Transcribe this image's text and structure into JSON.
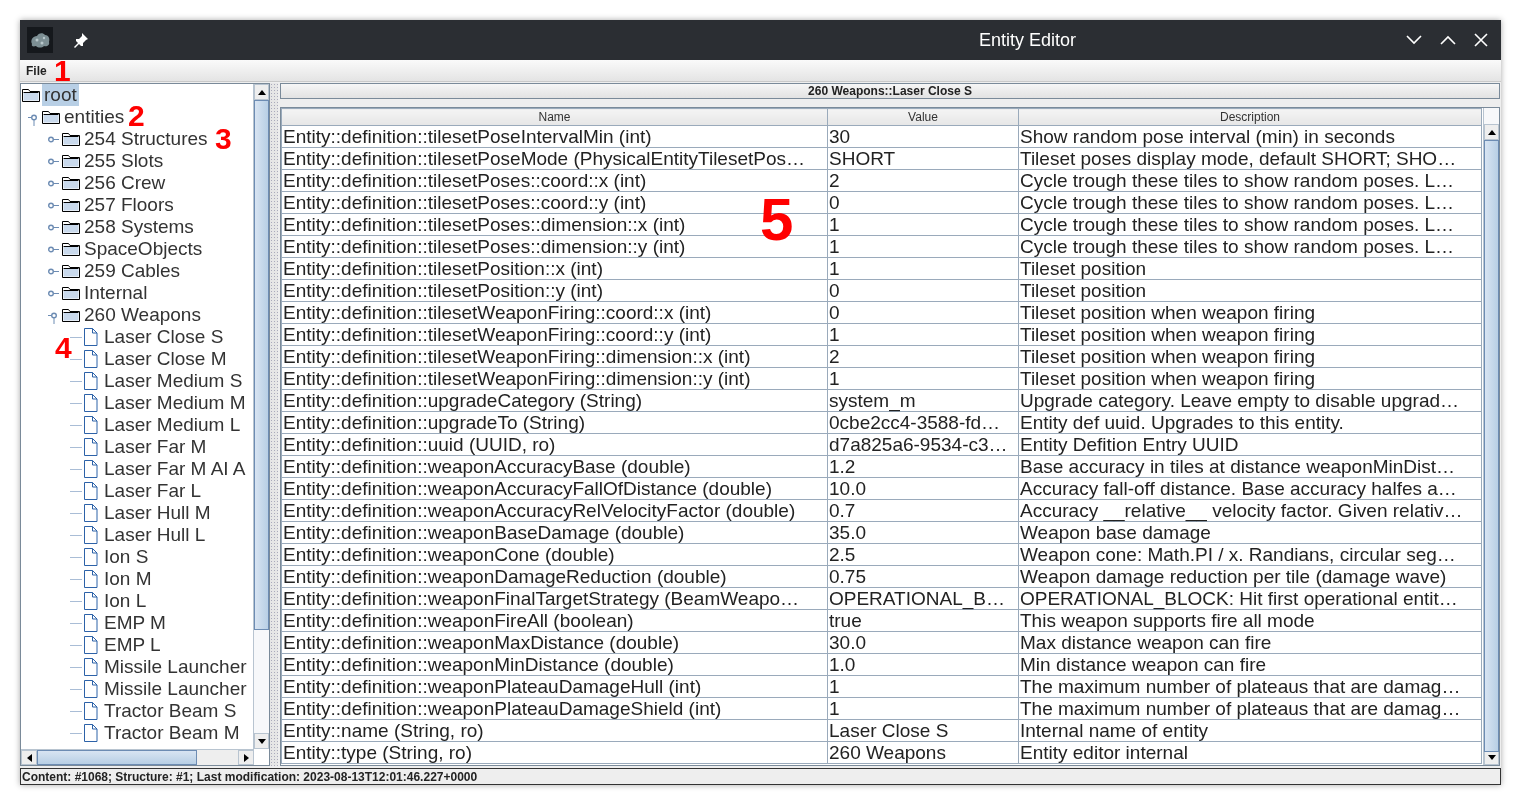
{
  "window": {
    "title": "Entity Editor"
  },
  "menu": [
    {
      "label": "File"
    }
  ],
  "tree": {
    "label": "root",
    "selected": true,
    "children": [
      {
        "label": "entities",
        "selected": false,
        "expanded": true,
        "children": [
          {
            "label": "254 Structures",
            "selected": false,
            "expanded": false
          },
          {
            "label": "255 Slots",
            "selected": false,
            "expanded": false
          },
          {
            "label": "256 Crew",
            "selected": false,
            "expanded": false
          },
          {
            "label": "257 Floors",
            "selected": false,
            "expanded": false
          },
          {
            "label": "258 Systems",
            "selected": false,
            "expanded": false
          },
          {
            "label": "SpaceObjects",
            "selected": false,
            "expanded": false
          },
          {
            "label": "259 Cables",
            "selected": false,
            "expanded": false
          },
          {
            "label": "Internal",
            "selected": false,
            "expanded": false
          },
          {
            "label": "260 Weapons",
            "selected": false,
            "expanded": true,
            "children": [
              {
                "label": "Laser Close S",
                "selected": false
              },
              {
                "label": "Laser Close M",
                "selected": false
              },
              {
                "label": "Laser Medium S",
                "selected": false
              },
              {
                "label": "Laser Medium M",
                "selected": false
              },
              {
                "label": "Laser Medium L",
                "selected": false
              },
              {
                "label": "Laser Far M",
                "selected": false
              },
              {
                "label": "Laser Far M AI A",
                "selected": false
              },
              {
                "label": "Laser Far L",
                "selected": false
              },
              {
                "label": "Laser Hull M",
                "selected": false
              },
              {
                "label": "Laser Hull L",
                "selected": false
              },
              {
                "label": "Ion S",
                "selected": false
              },
              {
                "label": "Ion M",
                "selected": false
              },
              {
                "label": "Ion L",
                "selected": false
              },
              {
                "label": "EMP M",
                "selected": false
              },
              {
                "label": "EMP L",
                "selected": false
              },
              {
                "label": "Missile Launcher",
                "selected": false
              },
              {
                "label": "Missile Launcher",
                "selected": false
              },
              {
                "label": "Tractor Beam S",
                "selected": false
              },
              {
                "label": "Tractor Beam M",
                "selected": false
              }
            ]
          }
        ]
      }
    ]
  },
  "detail": {
    "title": "260 Weapons::Laser Close S",
    "columns": [
      "Name",
      "Value",
      "Description"
    ],
    "rows": [
      [
        "Entity::definition::tilesetPoseIntervalMin (int)",
        "30",
        "Show random pose interval (min) in seconds"
      ],
      [
        "Entity::definition::tilesetPoseMode (PhysicalEntityTilesetPos…",
        "SHORT",
        "Tileset poses display mode, default SHORT; SHO…"
      ],
      [
        "Entity::definition::tilesetPoses::coord::x (int)",
        "2",
        "Cycle trough these tiles to show random poses. L…"
      ],
      [
        "Entity::definition::tilesetPoses::coord::y (int)",
        "0",
        "Cycle trough these tiles to show random poses. L…"
      ],
      [
        "Entity::definition::tilesetPoses::dimension::x (int)",
        "1",
        "Cycle trough these tiles to show random poses. L…"
      ],
      [
        "Entity::definition::tilesetPoses::dimension::y (int)",
        "1",
        "Cycle trough these tiles to show random poses. L…"
      ],
      [
        "Entity::definition::tilesetPosition::x (int)",
        "1",
        "Tileset position"
      ],
      [
        "Entity::definition::tilesetPosition::y (int)",
        "0",
        "Tileset position"
      ],
      [
        "Entity::definition::tilesetWeaponFiring::coord::x (int)",
        "0",
        "Tileset position when weapon firing"
      ],
      [
        "Entity::definition::tilesetWeaponFiring::coord::y (int)",
        "1",
        "Tileset position when weapon firing"
      ],
      [
        "Entity::definition::tilesetWeaponFiring::dimension::x (int)",
        "2",
        "Tileset position when weapon firing"
      ],
      [
        "Entity::definition::tilesetWeaponFiring::dimension::y (int)",
        "1",
        "Tileset position when weapon firing"
      ],
      [
        "Entity::definition::upgradeCategory (String)",
        "system_m",
        "Upgrade category. Leave empty to disable upgrad…"
      ],
      [
        "Entity::definition::upgradeTo (String)",
        "0cbe2cc4-3588-fd…",
        "Entity def uuid. Upgrades to this entity."
      ],
      [
        "Entity::definition::uuid (UUID, ro)",
        "d7a825a6-9534-c3…",
        "Entity Defition Entry UUID"
      ],
      [
        "Entity::definition::weaponAccuracyBase (double)",
        "1.2",
        "Base accuracy in tiles at distance weaponMinDist…"
      ],
      [
        "Entity::definition::weaponAccuracyFallOfDistance (double)",
        "10.0",
        "Accuracy fall-off distance. Base accuracy halfes a…"
      ],
      [
        "Entity::definition::weaponAccuracyRelVelocityFactor (double)",
        "0.7",
        "Accuracy __relative__ velocity factor. Given relativ…"
      ],
      [
        "Entity::definition::weaponBaseDamage (double)",
        "35.0",
        "Weapon base damage"
      ],
      [
        "Entity::definition::weaponCone (double)",
        "2.5",
        "Weapon cone: Math.PI / x. Randians, circular seg…"
      ],
      [
        "Entity::definition::weaponDamageReduction (double)",
        "0.75",
        "Weapon damage reduction per tile (damage wave)"
      ],
      [
        "Entity::definition::weaponFinalTargetStrategy (BeamWeapo…",
        "OPERATIONAL_B…",
        "OPERATIONAL_BLOCK: Hit first operational entit…"
      ],
      [
        "Entity::definition::weaponFireAll (boolean)",
        "true",
        "This weapon supports fire all mode"
      ],
      [
        "Entity::definition::weaponMaxDistance (double)",
        "30.0",
        "Max distance weapon can fire"
      ],
      [
        "Entity::definition::weaponMinDistance (double)",
        "1.0",
        "Min distance weapon can fire"
      ],
      [
        "Entity::definition::weaponPlateauDamageHull (int)",
        "1",
        "The maximum number of plateaus that are damag…"
      ],
      [
        "Entity::definition::weaponPlateauDamageShield (int)",
        "1",
        "The maximum number of plateaus that are damag…"
      ],
      [
        "Entity::name (String, ro)",
        "Laser Close S",
        "Internal name of entity"
      ],
      [
        "Entity::type (String, ro)",
        "260 Weapons",
        "Entity editor internal"
      ]
    ]
  },
  "status_bar": "Content: #1068; Structure: #1; Last modification: 2023-08-13T12:01:46.227+0000",
  "annotations": [
    {
      "text": "1"
    },
    {
      "text": "2"
    },
    {
      "text": "3"
    },
    {
      "text": "4"
    },
    {
      "text": "5"
    }
  ]
}
